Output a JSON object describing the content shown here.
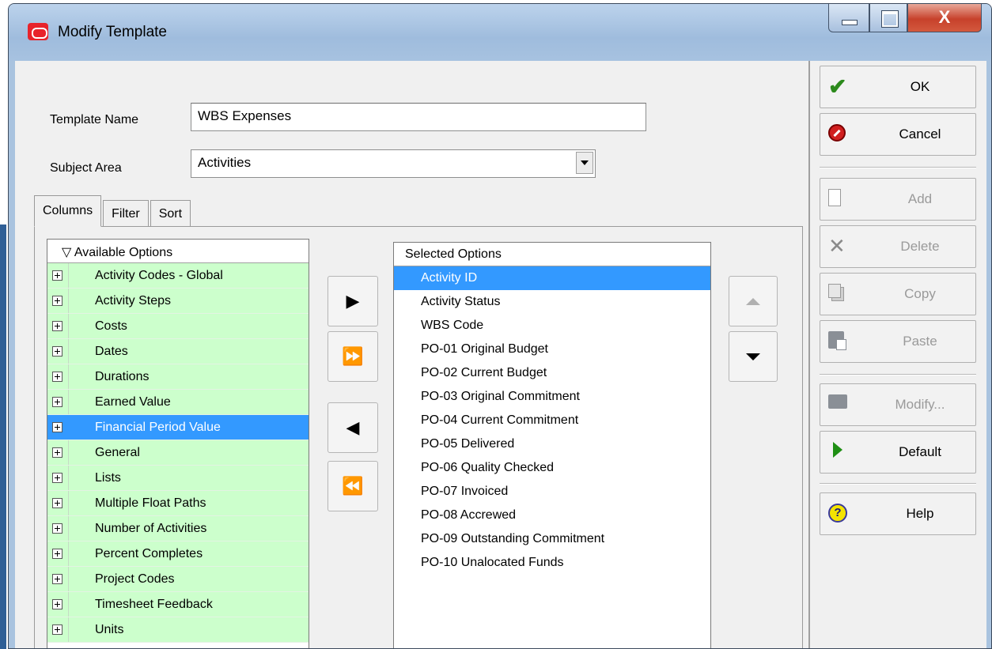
{
  "window": {
    "title": "Modify Template",
    "close_glyph": "X"
  },
  "form": {
    "template_name_label": "Template Name",
    "template_name_value": "WBS Expenses",
    "subject_area_label": "Subject Area",
    "subject_area_value": "Activities"
  },
  "tabs": [
    {
      "label": "Columns",
      "active": true
    },
    {
      "label": "Filter",
      "active": false
    },
    {
      "label": "Sort",
      "active": false
    }
  ],
  "available": {
    "header": "Available Options",
    "header_glyph": "▽",
    "items": [
      {
        "label": "Activity Codes - Global",
        "selected": false
      },
      {
        "label": "Activity Steps",
        "selected": false
      },
      {
        "label": "Costs",
        "selected": false
      },
      {
        "label": "Dates",
        "selected": false
      },
      {
        "label": "Durations",
        "selected": false
      },
      {
        "label": "Earned Value",
        "selected": false
      },
      {
        "label": "Financial Period Value",
        "selected": true
      },
      {
        "label": "General",
        "selected": false
      },
      {
        "label": "Lists",
        "selected": false
      },
      {
        "label": "Multiple Float Paths",
        "selected": false
      },
      {
        "label": "Number of Activities",
        "selected": false
      },
      {
        "label": "Percent Completes",
        "selected": false
      },
      {
        "label": "Project Codes",
        "selected": false
      },
      {
        "label": "Timesheet Feedback",
        "selected": false
      },
      {
        "label": "Units",
        "selected": false
      }
    ]
  },
  "move_buttons": {
    "add_one": "▶",
    "add_all": "⏩",
    "remove_one": "◀",
    "remove_all": "⏪"
  },
  "selected_list": {
    "header": "Selected Options",
    "items": [
      {
        "label": "Activity ID",
        "selected": true
      },
      {
        "label": "Activity Status",
        "selected": false
      },
      {
        "label": "WBS Code",
        "selected": false
      },
      {
        "label": "PO-01 Original Budget",
        "selected": false
      },
      {
        "label": "PO-02 Current Budget",
        "selected": false
      },
      {
        "label": "PO-03 Original Commitment",
        "selected": false
      },
      {
        "label": "PO-04 Current Commitment",
        "selected": false
      },
      {
        "label": "PO-05 Delivered",
        "selected": false
      },
      {
        "label": "PO-06 Quality Checked",
        "selected": false
      },
      {
        "label": "PO-07 Invoiced",
        "selected": false
      },
      {
        "label": "PO-08 Accrewed",
        "selected": false
      },
      {
        "label": "PO-09 Outstanding Commitment",
        "selected": false
      },
      {
        "label": "PO-10 Unalocated Funds",
        "selected": false
      }
    ]
  },
  "buttons": {
    "ok": "OK",
    "cancel": "Cancel",
    "add": "Add",
    "delete": "Delete",
    "copy": "Copy",
    "paste": "Paste",
    "modify": "Modify...",
    "default": "Default",
    "help": "Help"
  },
  "icons": {
    "ok": "checkmark-icon",
    "cancel": "stop-icon",
    "add": "new-document-icon",
    "delete": "x-icon",
    "copy": "copy-icon",
    "paste": "paste-icon",
    "modify": "monitor-icon",
    "default": "play-icon",
    "help": "help-icon"
  },
  "colors": {
    "available_row_bg": "#ccffcc",
    "selection_bg": "#3399ff",
    "close_button": "#c7412b",
    "ok_check": "#2c8a1c",
    "cancel_stop": "#d11f1f"
  }
}
